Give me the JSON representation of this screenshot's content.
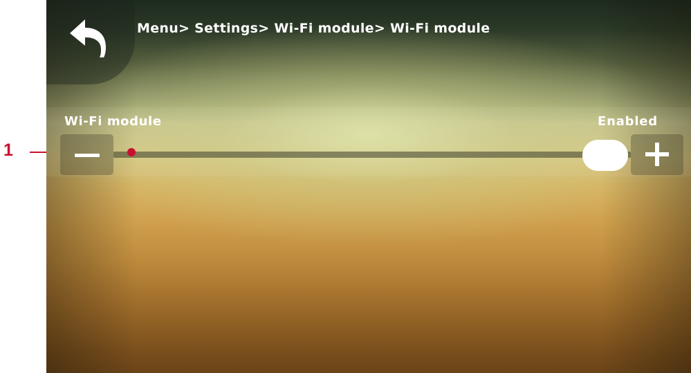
{
  "header": {
    "breadcrumb": "Menu> Settings> Wi-Fi module> Wi-Fi module",
    "back_icon": "back-arrow-icon"
  },
  "setting": {
    "label": "Wi-Fi module",
    "value": "Enabled",
    "minus_icon": "minus-icon",
    "plus_icon": "plus-icon",
    "slider_level": 1.0
  },
  "callout": {
    "number": "1",
    "color": "#c8102e"
  },
  "colors": {
    "text": "#ffffff",
    "thumb": "#ffffff"
  }
}
